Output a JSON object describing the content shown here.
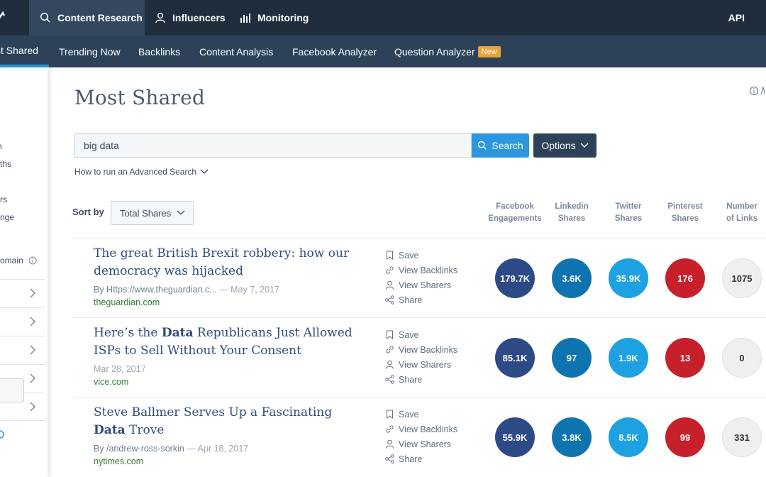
{
  "topnav": {
    "tabs": [
      {
        "label": "Content Research",
        "icon": "search-icon"
      },
      {
        "label": "Influencers",
        "icon": "user-icon"
      },
      {
        "label": "Monitoring",
        "icon": "bar-chart-icon"
      }
    ],
    "api_label": "API"
  },
  "subnav": {
    "tabs": [
      {
        "label": "st Shared"
      },
      {
        "label": "Trending Now"
      },
      {
        "label": "Backlinks"
      },
      {
        "label": "Content Analysis"
      },
      {
        "label": "Facebook Analyzer"
      },
      {
        "label": "Question Analyzer"
      }
    ],
    "new_badge": "New"
  },
  "sidebar": {
    "texts": [
      "h",
      "ths",
      "rs",
      "nge",
      "omain"
    ]
  },
  "main": {
    "title": "Most Shared",
    "search_value": "big data",
    "search_button": "Search",
    "options_button": "Options",
    "advanced_link": "How to run an Advanced Search",
    "sort_label": "Sort by",
    "sort_value": "Total Shares"
  },
  "columns": [
    {
      "line1": "Facebook",
      "line2": "Engagements"
    },
    {
      "line1": "Linkedin",
      "line2": "Shares"
    },
    {
      "line1": "Twitter",
      "line2": "Shares"
    },
    {
      "line1": "Pinterest",
      "line2": "Shares"
    },
    {
      "line1": "Number",
      "line2": "of Links"
    }
  ],
  "actions": {
    "save": "Save",
    "backlinks": "View Backlinks",
    "sharers": "View Sharers",
    "share": "Share"
  },
  "colors": {
    "facebook": "#2d4a86",
    "linkedin": "#0e74b0",
    "twitter": "#1da1e2",
    "pinterest": "#c6202a",
    "links": "#efefef",
    "accent": "#2c97de"
  },
  "articles": [
    {
      "title_pre": "The great British Brexit robbery: how our democracy was hijacked",
      "title_bold": "",
      "title_post": "",
      "author": "By Https://www.theguardian.c...",
      "date": " — May 7, 2017",
      "domain": "theguardian.com",
      "facebook": "179.7K",
      "linkedin": "3.6K",
      "twitter": "35.9K",
      "pinterest": "176",
      "links": "1075"
    },
    {
      "title_pre": "Here’s the ",
      "title_bold": "Data",
      "title_post": " Republicans Just Allowed ISPs to Sell Without Your Consent",
      "author": "",
      "date": "Mar 28, 2017",
      "domain": "vice.com",
      "facebook": "85.1K",
      "linkedin": "97",
      "twitter": "1.9K",
      "pinterest": "13",
      "links": "0"
    },
    {
      "title_pre": "Steve Ballmer Serves Up a Fascinating ",
      "title_bold": "Data",
      "title_post": " Trove",
      "author": "By /andrew-ross-sorkin",
      "date": " — Apr 18, 2017",
      "domain": "nytimes.com",
      "facebook": "55.9K",
      "linkedin": "3.8K",
      "twitter": "8.5K",
      "pinterest": "99",
      "links": "331"
    }
  ]
}
